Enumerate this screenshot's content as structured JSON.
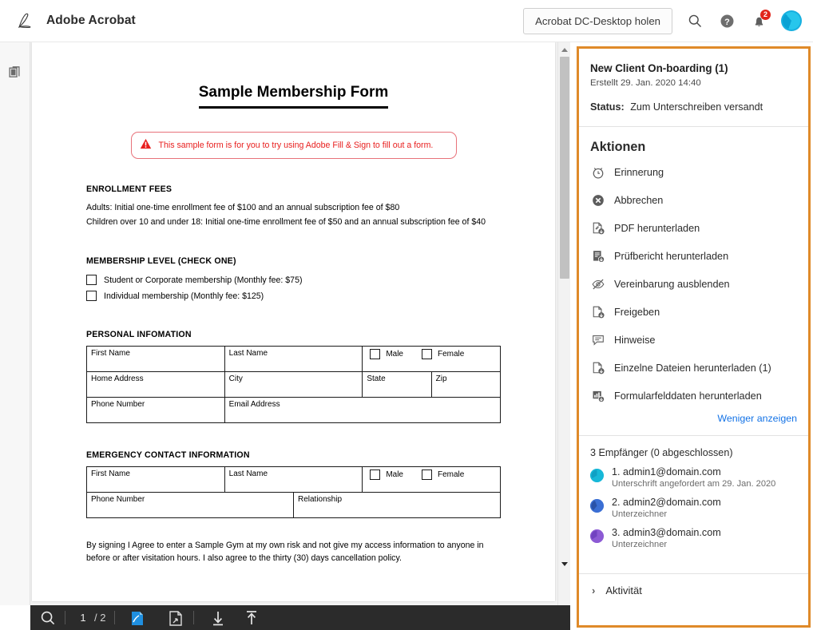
{
  "header": {
    "logo_icon": "acrobat-logo-icon",
    "title": "Adobe Acrobat",
    "get_desktop_label": "Acrobat DC-Desktop holen",
    "search_icon": "search-icon",
    "help_icon": "help-icon",
    "bell_icon": "bell-icon",
    "notification_count": "2",
    "avatar_icon": "user-avatar",
    "accent_blue": "#1473e6",
    "badge_red": "#e1251b"
  },
  "left_rail": {
    "thumbnails_icon": "page-thumbnails-icon"
  },
  "document": {
    "title": "Sample Membership Form",
    "warning_icon": "warning-triangle-icon",
    "warning_text": "This sample form is for you to try using Adobe Fill & Sign to fill out a form.",
    "warning_color": "#e8201f",
    "enrollment_heading": "ENROLLMENT FEES",
    "enrollment_lines": [
      "Adults: Initial one-time enrollment fee of $100 and an annual subscription fee of $80",
      "Children over 10 and under 18: Initial one-time enrollment fee of $50 and an annual subscription fee of $40"
    ],
    "membership_heading": "MEMBERSHIP LEVEL (CHECK ONE)",
    "membership_options": [
      "Student or Corporate membership (Monthly fee: $75)",
      "Individual membership (Monthly fee: $125)"
    ],
    "personal_heading": "PERSONAL INFOMATION",
    "personal_table": {
      "row1": [
        "First Name",
        "Last Name"
      ],
      "gender": [
        "Male",
        "Female"
      ],
      "row2": [
        "Home Address",
        "City",
        "State",
        "Zip"
      ],
      "row3": [
        "Phone Number",
        "Email Address"
      ]
    },
    "emergency_heading": "EMERGENCY CONTACT INFORMATION",
    "emergency_table": {
      "row1": [
        "First Name",
        "Last Name"
      ],
      "gender": [
        "Male",
        "Female"
      ],
      "row2": [
        "Phone Number",
        "Relationship"
      ]
    },
    "agreement_text": "By signing I Agree to enter a Sample Gym at my own risk and not give my access information to anyone in before or after visitation hours. I also agree to the thirty (30) days cancellation policy."
  },
  "bottom_toolbar": {
    "search_icon": "search-icon",
    "page_current": "1",
    "page_total": "/ 2",
    "fill_sign_icon": "fill-and-sign-icon",
    "export_pdf_icon": "export-pdf-icon",
    "download_icon": "download-icon",
    "upload_icon": "upload-icon"
  },
  "right_panel": {
    "highlight_color": "#df8a29",
    "agreement_title": "New Client On-boarding (1)",
    "created": "Erstellt 29. Jan. 2020 14:40",
    "status_label": "Status:",
    "status_value": "Zum Unterschreiben versandt",
    "actions_heading": "Aktionen",
    "actions": [
      {
        "label": "Erinnerung",
        "icon": "alarm-clock-icon"
      },
      {
        "label": "Abbrechen",
        "icon": "cancel-circle-icon"
      },
      {
        "label": "PDF herunterladen",
        "icon": "pdf-download-icon"
      },
      {
        "label": "Prüfbericht herunterladen",
        "icon": "report-download-icon"
      },
      {
        "label": "Vereinbarung ausblenden",
        "icon": "eye-off-icon"
      },
      {
        "label": "Freigeben",
        "icon": "share-file-icon"
      },
      {
        "label": "Hinweise",
        "icon": "comment-icon"
      },
      {
        "label": "Einzelne Dateien herunterladen (1)",
        "icon": "files-download-icon"
      },
      {
        "label": "Formularfelddaten herunterladen",
        "icon": "form-data-download-icon"
      }
    ],
    "show_less_label": "Weniger anzeigen",
    "recipients_count": "3 Empfänger (0 abgeschlossen)",
    "recipients": [
      {
        "name": "1. admin1@domain.com",
        "sub": "Unterschrift angefordert am 29. Jan. 2020",
        "color": "#17b8d8"
      },
      {
        "name": "2. admin2@domain.com",
        "sub": "Unterzeichner",
        "color": "#3b6fd4"
      },
      {
        "name": "3. admin3@domain.com",
        "sub": "Unterzeichner",
        "color": "#8c5ad4"
      }
    ],
    "activity_label": "Aktivität",
    "activity_chevron": "›"
  }
}
